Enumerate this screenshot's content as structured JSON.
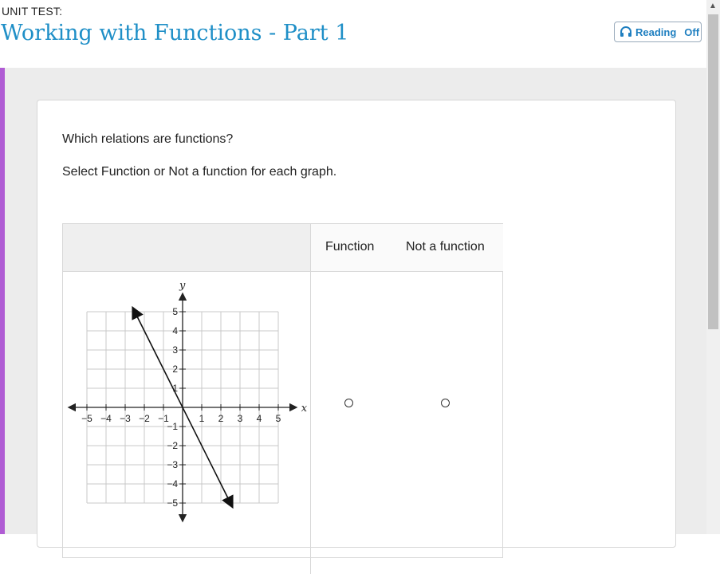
{
  "header": {
    "unit_label": "UNIT TEST:",
    "title": "Working with Functions - Part 1"
  },
  "reading": {
    "label": "Reading",
    "state": "Off"
  },
  "question": {
    "prompt": "Which relations are functions?",
    "instruction": "Select Function or Not a function for each graph."
  },
  "table": {
    "col_function": "Function",
    "col_not_function": "Not a function"
  },
  "graph": {
    "x_axis_label": "x",
    "y_axis_label": "y",
    "x_ticks": [
      "−5",
      "−4",
      "−3",
      "−2",
      "−1",
      "1",
      "2",
      "3",
      "4",
      "5"
    ],
    "y_ticks": [
      "5",
      "4",
      "3",
      "2",
      "1",
      "−1",
      "−2",
      "−3",
      "−4",
      "−5"
    ],
    "line_from": [
      -2.5,
      5
    ],
    "line_to": [
      2.5,
      -5
    ]
  },
  "colors": {
    "title": "#1f8fc7",
    "accent_bar": "#b05cd4",
    "reading": "#1f7fc0"
  },
  "icons": {
    "reading": "headphones-icon",
    "scroll_up": "chevron-up-icon"
  }
}
